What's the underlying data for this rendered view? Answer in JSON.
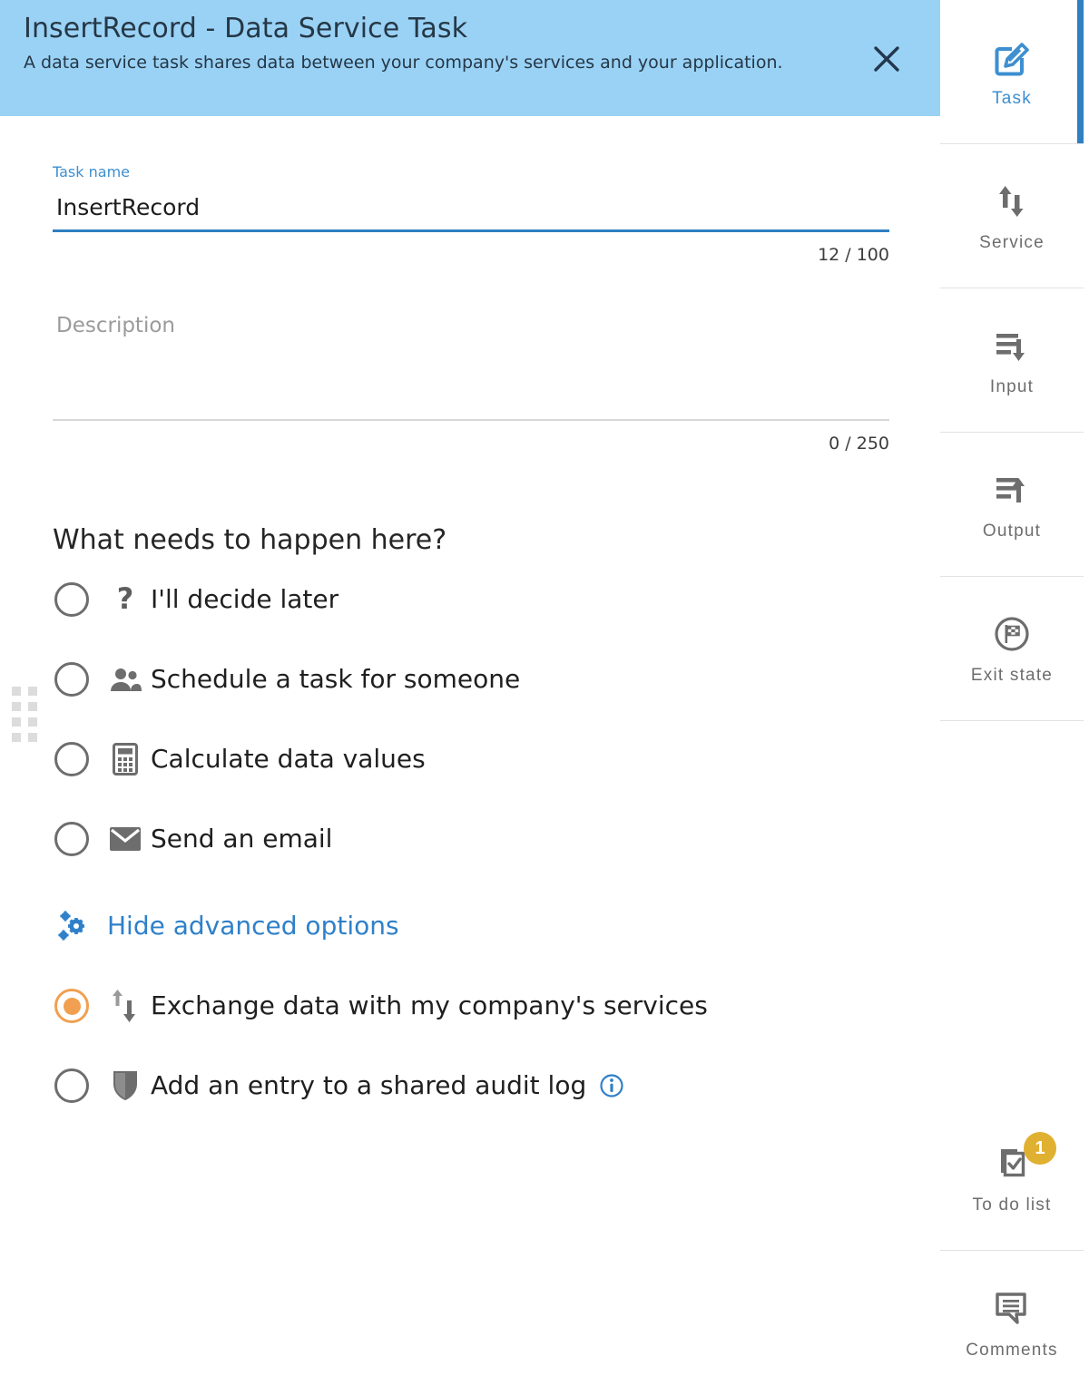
{
  "header": {
    "title": "InsertRecord - Data Service Task",
    "subtitle": "A data service task shares data between your company's services and your application.",
    "close_label": "close-icon",
    "bg_color": "#9ad2f5"
  },
  "form": {
    "task_name": {
      "label": "Task name",
      "value": "InsertRecord",
      "placeholder": "Task name",
      "counter": "12 / 100"
    },
    "description": {
      "label": "Description",
      "value": "",
      "placeholder": "Description",
      "counter": "0 / 250"
    }
  },
  "question": "What needs to happen here?",
  "options": [
    {
      "label": "I'll decide later",
      "icon": "question-mark-icon",
      "checked": false
    },
    {
      "label": "Schedule a task for someone",
      "icon": "people-icon",
      "checked": false
    },
    {
      "label": "Calculate data values",
      "icon": "calculator-icon",
      "checked": false
    },
    {
      "label": "Send an email",
      "icon": "envelope-icon",
      "checked": false
    }
  ],
  "advanced_toggle": {
    "label": "Hide advanced options",
    "icon": "gears-icon",
    "color": "#2f80c8"
  },
  "advanced_options": [
    {
      "label": "Exchange data with my company's services",
      "icon": "exchange-arrows-icon",
      "checked": true,
      "info": false
    },
    {
      "label": "Add an entry to a shared audit log",
      "icon": "shield-icon",
      "checked": false,
      "info": true
    }
  ],
  "selected_accent_color": "#f0a050",
  "sidebar": {
    "items": [
      {
        "label": "Task",
        "icon": "edit-square-icon",
        "active": true,
        "badge": null
      },
      {
        "label": "Service",
        "icon": "up-down-arrows-icon",
        "active": false,
        "badge": null
      },
      {
        "label": "Input",
        "icon": "lines-down-arrow-icon",
        "active": false,
        "badge": null
      },
      {
        "label": "Output",
        "icon": "lines-up-arrow-icon",
        "active": false,
        "badge": null
      },
      {
        "label": "Exit state",
        "icon": "checkered-flag-circle-icon",
        "active": false,
        "badge": null
      }
    ],
    "bottom_items": [
      {
        "label": "To do list",
        "icon": "checklist-copy-icon",
        "active": false,
        "badge": "1"
      },
      {
        "label": "Comments",
        "icon": "comment-bubble-icon",
        "active": false,
        "badge": null
      }
    ]
  }
}
